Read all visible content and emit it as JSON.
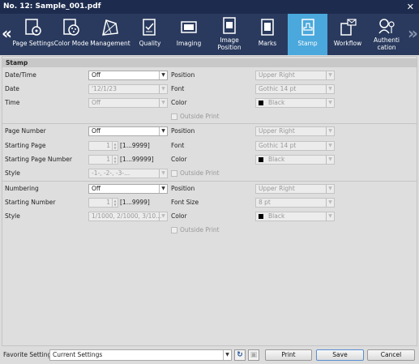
{
  "window": {
    "title": "No. 12: Sample_001.pdf"
  },
  "tabs": [
    {
      "label": "Page Settings"
    },
    {
      "label": "Color Mode"
    },
    {
      "label": "Management"
    },
    {
      "label": "Quality"
    },
    {
      "label": "Imaging"
    },
    {
      "label": "Image\nPosition"
    },
    {
      "label": "Marks"
    },
    {
      "label": "Stamp"
    },
    {
      "label": "Workflow"
    },
    {
      "label": "Authenti\ncation"
    }
  ],
  "section_title": "Stamp",
  "datetime": {
    "label": "Date/Time",
    "value": "Off",
    "date_label": "Date",
    "date_value": "'12/1/23",
    "time_label": "Time",
    "time_value": "Off",
    "position_label": "Position",
    "position_value": "Upper Right",
    "font_label": "Font",
    "font_value": "Gothic 14 pt",
    "color_label": "Color",
    "color_value": "Black",
    "outside_print": "Outside Print"
  },
  "page_number": {
    "label": "Page Number",
    "value": "Off",
    "start_label": "Starting Page",
    "start_value": "1",
    "start_range": "[1...9999]",
    "start_num_label": "Starting Page Number",
    "start_num_value": "1",
    "start_num_range": "[1...99999]",
    "style_label": "Style",
    "style_value": "-1-, -2-, -3-...",
    "position_label": "Position",
    "position_value": "Upper Right",
    "font_label": "Font",
    "font_value": "Gothic 14 pt",
    "color_label": "Color",
    "color_value": "Black",
    "outside_print": "Outside Print"
  },
  "numbering": {
    "label": "Numbering",
    "value": "Off",
    "start_label": "Starting Number",
    "start_value": "1",
    "start_range": "[1...9999]",
    "style_label": "Style",
    "style_value": "1/1000, 2/1000, 3/10...",
    "position_label": "Position",
    "position_value": "Upper Right",
    "fontsize_label": "Font Size",
    "fontsize_value": "8 pt",
    "color_label": "Color",
    "color_value": "Black",
    "outside_print": "Outside Print"
  },
  "footer": {
    "favorite_label": "Favorite Setting",
    "favorite_value": "Current Settings",
    "print": "Print",
    "save": "Save",
    "cancel": "Cancel"
  },
  "colors": {
    "title_bar": "#1d2c4e",
    "toolbar": "#2a3a5e",
    "active_tab": "#4aa8dc"
  }
}
